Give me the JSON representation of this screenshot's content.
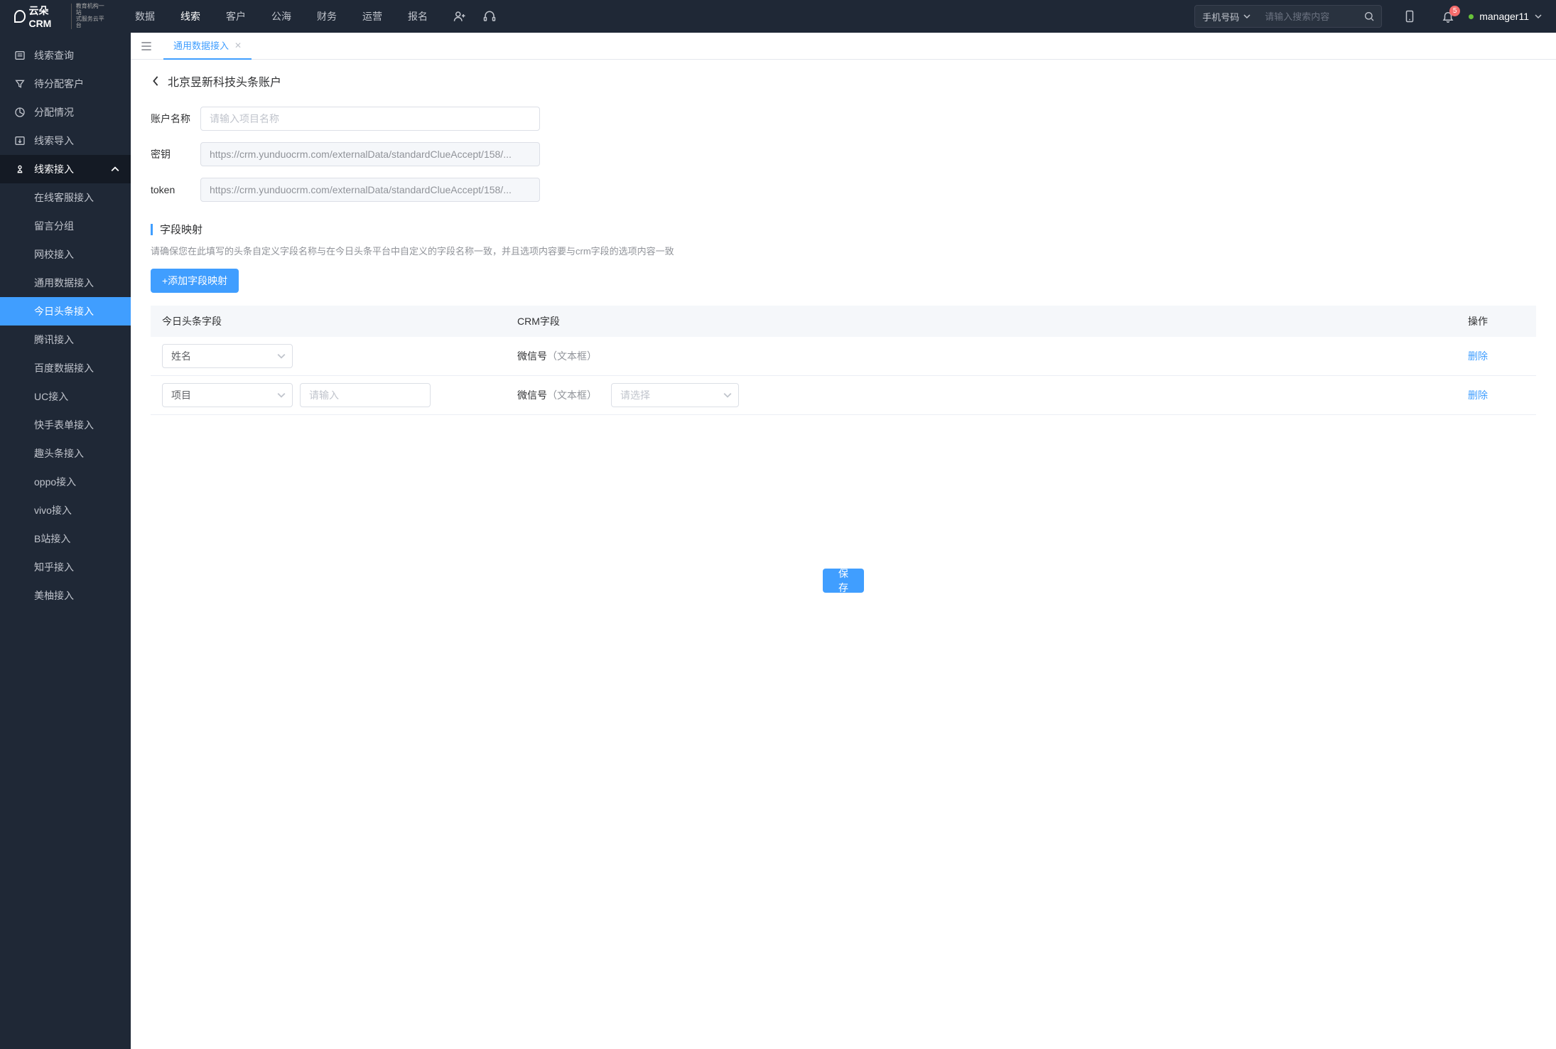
{
  "header": {
    "logo_main": "云朵CRM",
    "logo_sub1": "教育机构一站",
    "logo_sub2": "式服务云平台",
    "nav": [
      "数据",
      "线索",
      "客户",
      "公海",
      "财务",
      "运营",
      "报名"
    ],
    "nav_active_index": 1,
    "search_type": "手机号码",
    "search_placeholder": "请输入搜索内容",
    "badge": "5",
    "username": "manager11"
  },
  "sidebar": {
    "top": [
      {
        "label": "线索查询"
      },
      {
        "label": "待分配客户"
      },
      {
        "label": "分配情况"
      },
      {
        "label": "线索导入"
      }
    ],
    "group_label": "线索接入",
    "sub": [
      "在线客服接入",
      "留言分组",
      "网校接入",
      "通用数据接入",
      "今日头条接入",
      "腾讯接入",
      "百度数据接入",
      "UC接入",
      "快手表单接入",
      "趣头条接入",
      "oppo接入",
      "vivo接入",
      "B站接入",
      "知乎接入",
      "美柚接入"
    ],
    "sub_active_index": 4
  },
  "tabs": {
    "label": "通用数据接入"
  },
  "page": {
    "title": "北京昱新科技头条账户",
    "form": {
      "name_label": "账户名称",
      "name_placeholder": "请输入项目名称",
      "key_label": "密钥",
      "key_value": "https://crm.yunduocrm.com/externalData/standardClueAccept/158/...",
      "token_label": "token",
      "token_value": "https://crm.yunduocrm.com/externalData/standardClueAccept/158/..."
    },
    "section": {
      "title": "字段映射",
      "desc": "请确保您在此填写的头条自定义字段名称与在今日头条平台中自定义的字段名称一致，并且选项内容要与crm字段的选项内容一致",
      "add_btn": "+添加字段映射"
    },
    "table": {
      "headers": [
        "今日头条字段",
        "CRM字段",
        "操作"
      ],
      "rows": [
        {
          "select": "姓名",
          "input": "",
          "crm_label": "微信号",
          "crm_hint": "（文本框）",
          "crm_select": "",
          "delete": "删除"
        },
        {
          "select": "项目",
          "input": "",
          "input_placeholder": "请输入",
          "crm_label": "微信号",
          "crm_hint": "（文本框）",
          "crm_select": "",
          "crm_select_placeholder": "请选择",
          "delete": "删除"
        }
      ]
    },
    "save": "保存"
  }
}
